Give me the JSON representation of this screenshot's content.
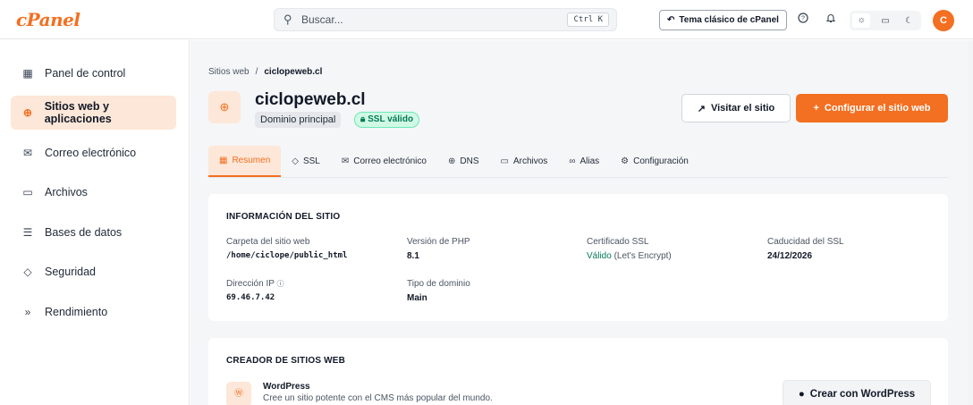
{
  "header": {
    "logo": "cPanel",
    "search_placeholder": "Buscar...",
    "search_shortcut": "Ctrl K",
    "classic_theme_label": "Tema clásico de cPanel",
    "avatar_initial": "C",
    "accent_color": "#f36f21"
  },
  "sidebar": {
    "items": [
      {
        "label": "Panel de control",
        "icon": "grid-icon"
      },
      {
        "label": "Sitios web y aplicaciones",
        "icon": "globe-icon",
        "active": true
      },
      {
        "label": "Correo electrónico",
        "icon": "mail-icon"
      },
      {
        "label": "Archivos",
        "icon": "folder-icon"
      },
      {
        "label": "Bases de datos",
        "icon": "database-icon"
      },
      {
        "label": "Seguridad",
        "icon": "shield-icon"
      },
      {
        "label": "Rendimiento",
        "icon": "fast-forward-icon"
      }
    ]
  },
  "breadcrumb": {
    "parent": "Sitios web",
    "separator": "/",
    "current": "ciclopeweb.cl"
  },
  "site": {
    "title": "ciclopeweb.cl",
    "domain_badge": "Dominio principal",
    "ssl_badge": "SSL válido",
    "visit_label": "Visitar el sitio",
    "configure_label": "Configurar el sitio web"
  },
  "tabs": [
    {
      "label": "Resumen",
      "active": true
    },
    {
      "label": "SSL"
    },
    {
      "label": "Correo electrónico"
    },
    {
      "label": "DNS"
    },
    {
      "label": "Archivos"
    },
    {
      "label": "Alias"
    },
    {
      "label": "Configuración"
    }
  ],
  "info": {
    "heading": "INFORMACIÓN DEL SITIO",
    "folder_label": "Carpeta del sitio web",
    "folder_value": "/home/ciclope/public_html",
    "php_label": "Versión de PHP",
    "php_value": "8.1",
    "cert_label": "Certificado SSL",
    "cert_status": "Válido",
    "cert_issuer": "(Let's Encrypt)",
    "expiry_label": "Caducidad del SSL",
    "expiry_value": "24/12/2026",
    "ip_label": "Dirección IP",
    "ip_value": "69.46.7.42",
    "domain_type_label": "Tipo de dominio",
    "domain_type_value": "Main"
  },
  "builder": {
    "heading": "CREADOR DE SITIOS WEB",
    "wp_name": "WordPress",
    "wp_desc": "Cree un sitio potente con el CMS más popular del mundo.",
    "wp_button": "Crear con WordPress"
  }
}
